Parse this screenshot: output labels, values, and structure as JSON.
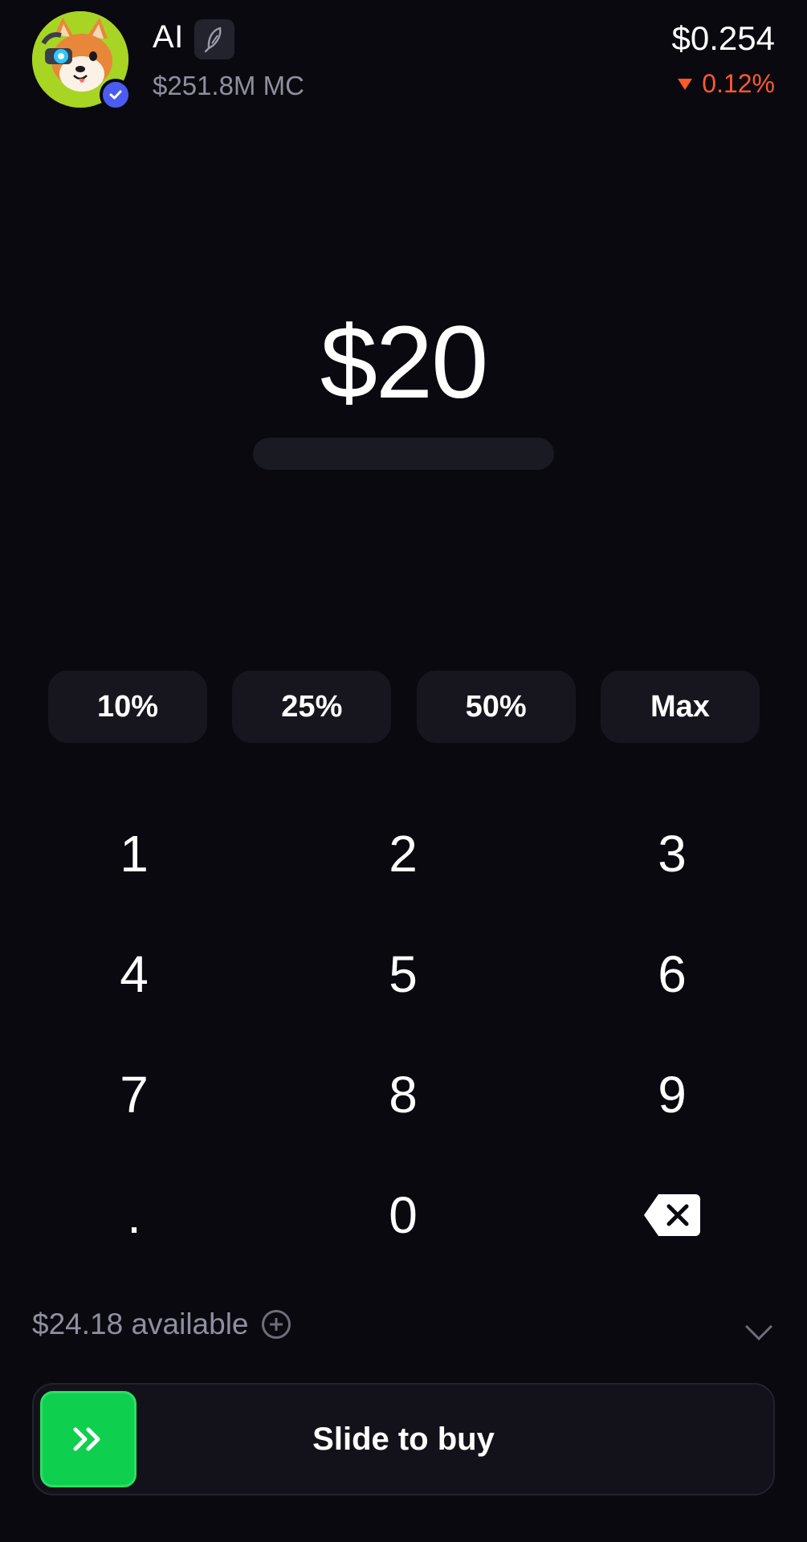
{
  "token": {
    "name": "AI",
    "market_cap": "$251.8M MC",
    "price": "$0.254",
    "change": "0.12%",
    "change_direction": "down",
    "change_color": "#ff5a2a",
    "avatar_icon": "shiba-cyborg-avatar",
    "badge_icon": "pump-feather-icon",
    "verified_icon": "verified-check-icon"
  },
  "amount": {
    "value": "$20"
  },
  "quick_amounts": [
    "10%",
    "25%",
    "50%",
    "Max"
  ],
  "keypad": {
    "keys": [
      "1",
      "2",
      "3",
      "4",
      "5",
      "6",
      "7",
      "8",
      "9",
      ".",
      "0"
    ],
    "backspace_icon": "backspace-icon"
  },
  "balance": {
    "available": "$24.18 available",
    "add_icon": "plus-circle-icon",
    "expand_icon": "chevron-down-icon"
  },
  "slide_to_buy": {
    "label": "Slide to buy",
    "handle_icon": "double-chevron-right-icon",
    "accent": "#0fcf4f"
  }
}
